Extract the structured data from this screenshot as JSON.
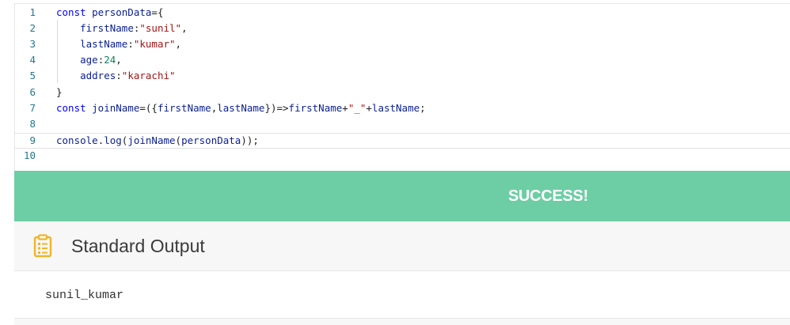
{
  "editor": {
    "lines": [
      {
        "number": "1",
        "tokens": [
          [
            "kw",
            "const "
          ],
          [
            "id",
            "personData"
          ],
          [
            "punc",
            "={"
          ]
        ]
      },
      {
        "number": "2",
        "tokens": [
          [
            "punc",
            "    "
          ],
          [
            "id",
            "firstName"
          ],
          [
            "punc",
            ":"
          ],
          [
            "str",
            "\"sunil\""
          ],
          [
            "punc",
            ","
          ]
        ]
      },
      {
        "number": "3",
        "tokens": [
          [
            "punc",
            "    "
          ],
          [
            "id",
            "lastName"
          ],
          [
            "punc",
            ":"
          ],
          [
            "str",
            "\"kumar\""
          ],
          [
            "punc",
            ","
          ]
        ]
      },
      {
        "number": "4",
        "tokens": [
          [
            "punc",
            "    "
          ],
          [
            "id",
            "age"
          ],
          [
            "punc",
            ":"
          ],
          [
            "num",
            "24"
          ],
          [
            "punc",
            ","
          ]
        ]
      },
      {
        "number": "5",
        "tokens": [
          [
            "punc",
            "    "
          ],
          [
            "id",
            "addres"
          ],
          [
            "punc",
            ":"
          ],
          [
            "str",
            "\"karachi\""
          ]
        ]
      },
      {
        "number": "6",
        "tokens": [
          [
            "punc",
            "}"
          ]
        ]
      },
      {
        "number": "7",
        "tokens": [
          [
            "kw",
            "const "
          ],
          [
            "id",
            "joinName"
          ],
          [
            "punc",
            "=({"
          ],
          [
            "id",
            "firstName"
          ],
          [
            "punc",
            ","
          ],
          [
            "id",
            "lastName"
          ],
          [
            "punc",
            "})=>"
          ],
          [
            "id",
            "firstName"
          ],
          [
            "punc",
            "+"
          ],
          [
            "str",
            "\"_\""
          ],
          [
            "punc",
            "+"
          ],
          [
            "id",
            "lastName"
          ],
          [
            "punc",
            ";"
          ]
        ]
      },
      {
        "number": "8",
        "tokens": []
      },
      {
        "number": "9",
        "tokens": [
          [
            "id",
            "console"
          ],
          [
            "punc",
            "."
          ],
          [
            "id",
            "log"
          ],
          [
            "punc",
            "("
          ],
          [
            "id",
            "joinName"
          ],
          [
            "punc",
            "("
          ],
          [
            "id",
            "personData"
          ],
          [
            "punc",
            "));"
          ]
        ]
      },
      {
        "number": "10",
        "tokens": []
      }
    ],
    "active_line": 9
  },
  "banner": {
    "text": "SUCCESS!",
    "color": "#6dcda4"
  },
  "output": {
    "icon": "clipboard-list-icon",
    "icon_color": "#f0b429",
    "title": "Standard Output",
    "text": "sunil_kumar"
  }
}
